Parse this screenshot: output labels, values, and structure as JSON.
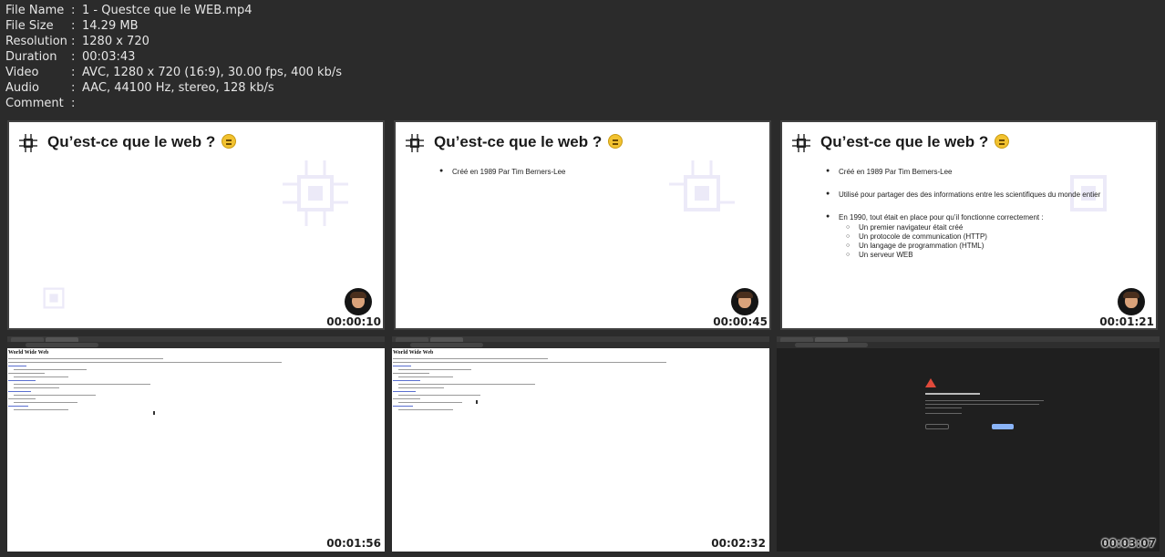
{
  "info": [
    {
      "label": "File Name",
      "value": "1 - Questce que le WEB.mp4"
    },
    {
      "label": "File Size",
      "value": "14.29 MB"
    },
    {
      "label": "Resolution",
      "value": "1280 x 720"
    },
    {
      "label": "Duration",
      "value": "00:03:43"
    },
    {
      "label": "Video",
      "value": "AVC, 1280 x 720 (16:9), 30.00 fps, 400 kb/s"
    },
    {
      "label": "Audio",
      "value": "AAC, 44100 Hz, stereo, 128 kb/s"
    },
    {
      "label": "Comment",
      "value": ""
    }
  ],
  "colon": ":",
  "slides": {
    "title": "Qu’est-ce que le web ?",
    "bullet1": "Créé en 1989 Par Tim Berners-Lee",
    "bullet2": "Utilisé pour partager des des informations entre les scientifiques du monde entier",
    "bullet3": "En 1990, tout était en place pour qu’il fonctionne correctement :",
    "sub": [
      "Un premier navigateur était créé",
      "Un protocole de communication (HTTP)",
      "Un langage de programmation (HTML)",
      "Un serveur WEB"
    ]
  },
  "browser": {
    "page_title": "World Wide Web"
  },
  "timecodes": [
    "00:00:10",
    "00:00:45",
    "00:01:21",
    "00:01:56",
    "00:02:32",
    "00:03:07"
  ]
}
